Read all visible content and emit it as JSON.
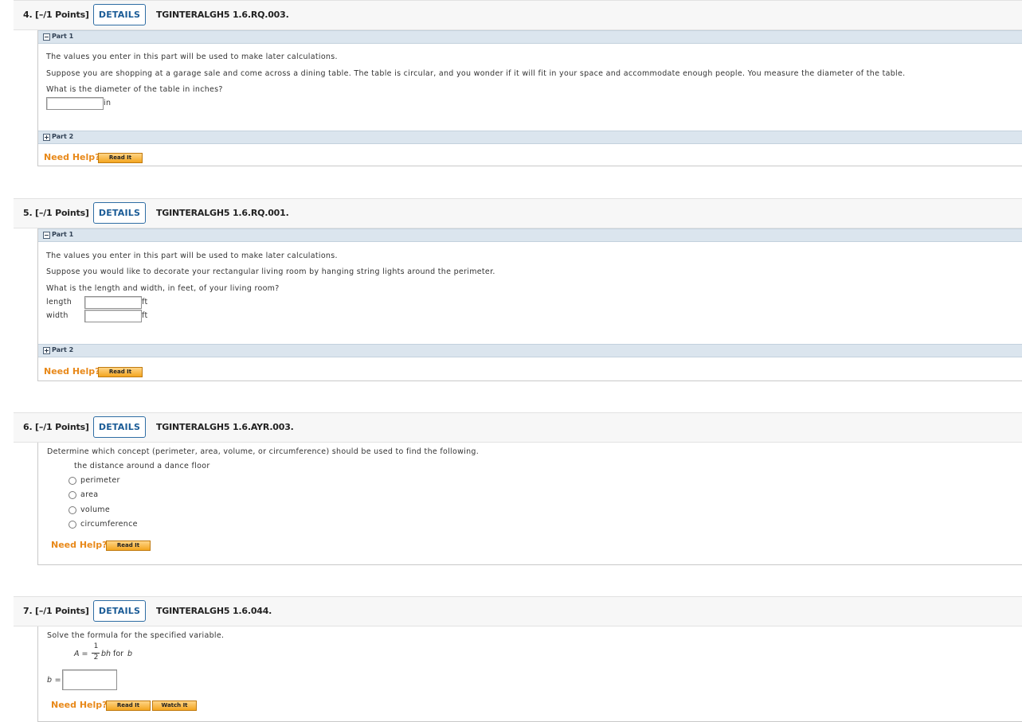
{
  "questions": [
    {
      "number": "4.  [–/1 Points]",
      "details_label": "DETAILS",
      "code": "TGINTERALGH5 1.6.RQ.003.",
      "part1_label": "Part 1",
      "part2_label": "Part 2",
      "lines": [
        "The values you enter in this part will be used to make later calculations.",
        "Suppose you are shopping at a garage sale and come across a dining table. The table is circular, and you wonder if it will fit in your space and accommodate enough people. You measure the diameter of the table.",
        "What is the diameter of the table in inches?"
      ],
      "unit": "in",
      "answer_value": "",
      "need_help": "Need Help?",
      "read_it": "Read It"
    },
    {
      "number": "5.  [–/1 Points]",
      "details_label": "DETAILS",
      "code": "TGINTERALGH5 1.6.RQ.001.",
      "part1_label": "Part 1",
      "part2_label": "Part 2",
      "lines": [
        "The values you enter in this part will be used to make later calculations.",
        "Suppose you would like to decorate your rectangular living room by hanging string lights around the perimeter.",
        "What is the length and width, in feet, of your living room?"
      ],
      "fields": [
        {
          "label": "length",
          "unit": "ft",
          "value": ""
        },
        {
          "label": "width",
          "unit": "ft",
          "value": ""
        }
      ],
      "need_help": "Need Help?",
      "read_it": "Read It"
    },
    {
      "number": "6.  [–/1 Points]",
      "details_label": "DETAILS",
      "code": "TGINTERALGH5 1.6.AYR.003.",
      "prompt": "Determine which concept (perimeter, area, volume, or circumference) should be used to find the following.",
      "item": "the distance around a dance floor",
      "options": [
        "perimeter",
        "area",
        "volume",
        "circumference"
      ],
      "need_help": "Need Help?",
      "read_it": "Read It"
    },
    {
      "number": "7.  [–/1 Points]",
      "details_label": "DETAILS",
      "code": "TGINTERALGH5 1.6.044.",
      "prompt": "Solve the formula for the specified variable.",
      "formula_lhs": "A =",
      "frac_num": "1",
      "frac_den": "2",
      "formula_rhs": "bh",
      "formula_for": "for",
      "formula_var": "b",
      "answer_label": "b =",
      "answer_value": "",
      "need_help": "Need Help?",
      "read_it": "Read It",
      "watch_it": "Watch It"
    }
  ]
}
